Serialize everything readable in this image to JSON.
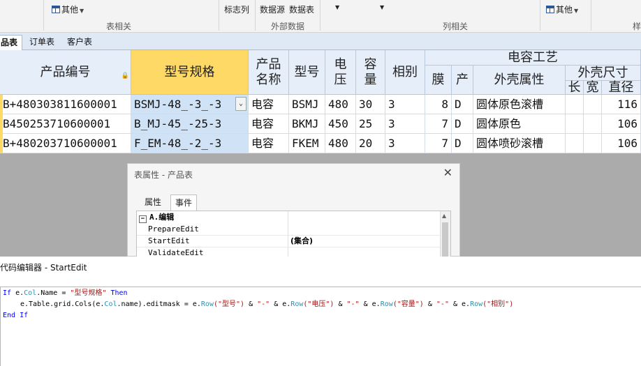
{
  "ribbon": {
    "other_label_1": "其他",
    "other_label_2": "其他",
    "lbl_marker_col": "标志列",
    "lbl_data_source": "数据源",
    "lbl_data_table": "数据表",
    "groups": {
      "table": "表相关",
      "external": "外部数据",
      "column": "列相关",
      "style": "样"
    }
  },
  "tabs": [
    {
      "label": "品表",
      "active": true
    },
    {
      "label": "订单表",
      "active": false
    },
    {
      "label": "客户表",
      "active": false
    }
  ],
  "grid": {
    "headers": {
      "product_no": "产品编号",
      "spec": "型号规格",
      "name": "产品\n名称",
      "model": "型号",
      "voltage": "电\n压",
      "capacity": "容\n量",
      "phase": "相别",
      "film": "膜",
      "prod": "产",
      "shell_attr": "外壳属性",
      "cap_process": "电容工艺",
      "shell_size": "外壳尺寸",
      "length": "长",
      "width": "宽",
      "diameter": "直径"
    },
    "rows": [
      {
        "product_no": "B+480303811600001",
        "spec": "BSMJ-48_-3_-3",
        "name": "电容",
        "model": "BSMJ",
        "voltage": "480",
        "capacity": "30",
        "phase": "3",
        "film": "8",
        "prod": "D",
        "shell_attr": "圆体原色滚槽",
        "length": "",
        "width": "",
        "diameter": "116"
      },
      {
        "product_no": "B450253710600001",
        "spec": "B_MJ-45_-25-3",
        "name": "电容",
        "model": "BKMJ",
        "voltage": "450",
        "capacity": "25",
        "phase": "3",
        "film": "7",
        "prod": "D",
        "shell_attr": "圆体原色",
        "length": "",
        "width": "",
        "diameter": "106"
      },
      {
        "product_no": "B+480203710600001",
        "spec": "F_EM-48_-2_-3",
        "name": "电容",
        "model": "FKEM",
        "voltage": "480",
        "capacity": "20",
        "phase": "3",
        "film": "7",
        "prod": "D",
        "shell_attr": "圆体喷砂滚槽",
        "length": "",
        "width": "",
        "diameter": "106"
      }
    ]
  },
  "dialog": {
    "title": "表属性 - 产品表",
    "tab_props": "属性",
    "tab_events": "事件",
    "category": "A.编辑",
    "rows": [
      {
        "name": "PrepareEdit",
        "value": ""
      },
      {
        "name": "StartEdit",
        "value": "(集合)"
      },
      {
        "name": "ValidateEdit",
        "value": ""
      }
    ]
  },
  "editor": {
    "title": "代码编辑器 - StartEdit",
    "line1": {
      "kw_if": "If",
      "obj": "e",
      "col": "Col",
      "name": "Name",
      "eq": "=",
      "str": "\"型号规格\"",
      "kw_then": "Then"
    },
    "line2": {
      "a": "e.Table.grid.Cols(e.",
      "b": "Col",
      "c": ".name).editmask = e.",
      "row": "Row",
      "s1": "(\"型号\")",
      "s2": "\"-\"",
      "s3": "(\"电压\")",
      "s4": "(\"容量\")",
      "s5": "(\"相别\")"
    },
    "line3": {
      "kw_end": "End",
      "kw_if": "If"
    }
  }
}
